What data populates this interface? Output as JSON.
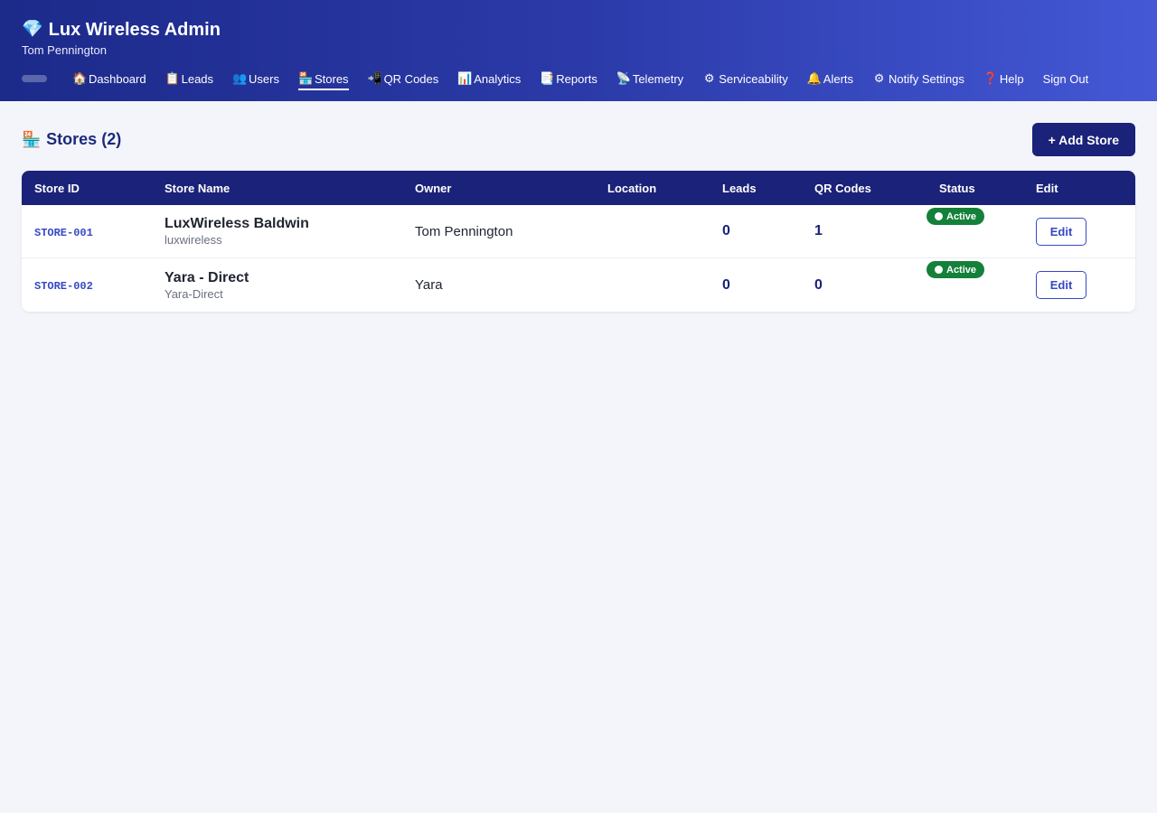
{
  "header": {
    "title": "Lux Wireless Admin",
    "title_icon": "gem-icon",
    "user": "Tom Pennington"
  },
  "nav": [
    {
      "label": "Dashboard",
      "icon": "🏠",
      "icon_name": "house-icon",
      "active": false
    },
    {
      "label": "Leads",
      "icon": "📋",
      "icon_name": "clipboard-icon",
      "active": false
    },
    {
      "label": "Users",
      "icon": "👥",
      "icon_name": "users-icon",
      "active": false
    },
    {
      "label": "Stores",
      "icon": "🏪",
      "icon_name": "store-icon",
      "active": true
    },
    {
      "label": "QR Codes",
      "icon": "📲",
      "icon_name": "phone-qr-icon",
      "active": false
    },
    {
      "label": "Analytics",
      "icon": "📊",
      "icon_name": "bar-chart-icon",
      "active": false
    },
    {
      "label": "Reports",
      "icon": "📑",
      "icon_name": "report-icon",
      "active": false
    },
    {
      "label": "Telemetry",
      "icon": "📡",
      "icon_name": "satellite-icon",
      "active": false
    },
    {
      "label": "Serviceability",
      "icon": "⚙",
      "icon_name": "gear-icon",
      "active": false
    },
    {
      "label": "Alerts",
      "icon": "🔔",
      "icon_name": "bell-icon",
      "active": false
    },
    {
      "label": "Notify Settings",
      "icon": "⚙",
      "icon_name": "gear-icon",
      "active": false
    },
    {
      "label": "Help",
      "icon": "❓",
      "icon_name": "question-icon",
      "active": false
    },
    {
      "label": "Sign Out",
      "icon": "",
      "icon_name": "",
      "active": false
    }
  ],
  "page": {
    "title": "Stores (2)",
    "title_icon": "store-icon",
    "add_button": "+ Add Store"
  },
  "table": {
    "columns": [
      "Store ID",
      "Store Name",
      "Owner",
      "Location",
      "Leads",
      "QR Codes",
      "Status",
      "Edit"
    ],
    "rows": [
      {
        "id": "STORE-001",
        "name": "LuxWireless Baldwin",
        "slug": "luxwireless",
        "owner": "Tom Pennington",
        "location": "",
        "leads": "0",
        "qr_codes": "1",
        "status": "Active",
        "edit": "Edit"
      },
      {
        "id": "STORE-002",
        "name": "Yara - Direct",
        "slug": "Yara-Direct",
        "owner": "Yara",
        "location": "",
        "leads": "0",
        "qr_codes": "0",
        "status": "Active",
        "edit": "Edit"
      }
    ]
  },
  "colors": {
    "header_gradient_start": "#1c2a8a",
    "header_gradient_end": "#4458d6",
    "table_header": "#1a2279",
    "status_active": "#14803a",
    "link": "#3548c4",
    "page_background": "#f3f5fa"
  }
}
